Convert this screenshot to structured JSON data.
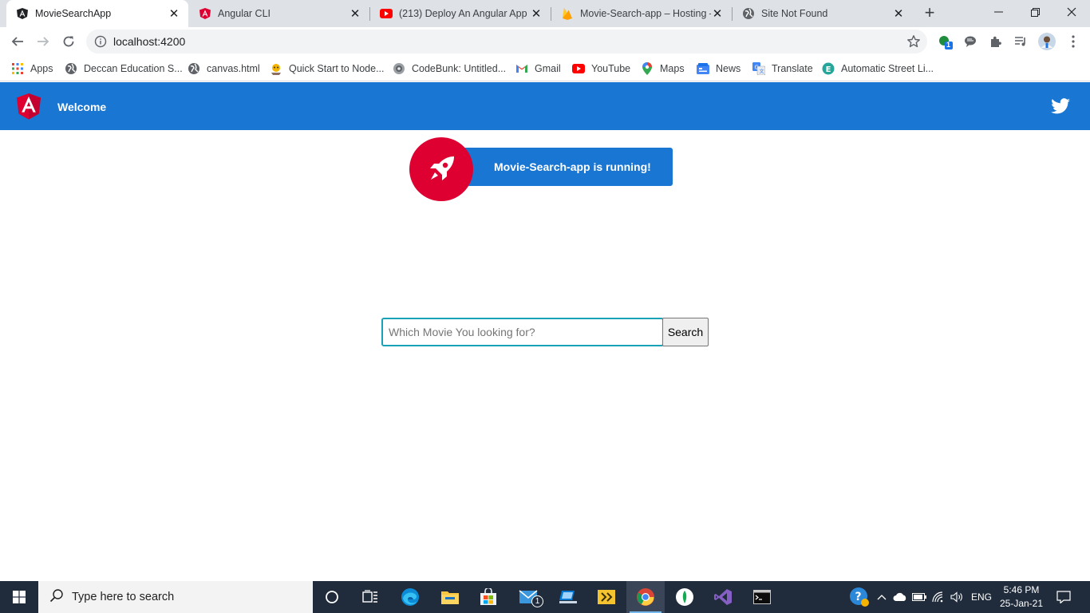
{
  "browser": {
    "tabs": [
      {
        "title": "MovieSearchApp",
        "icon": "angular-icon",
        "active": true
      },
      {
        "title": "Angular CLI",
        "icon": "angular-icon"
      },
      {
        "title": "(213) Deploy An Angular App T",
        "icon": "youtube-icon"
      },
      {
        "title": "Movie-Search-app – Hosting –",
        "icon": "firebase-icon"
      },
      {
        "title": "Site Not Found",
        "icon": "globe-icon"
      }
    ],
    "new_tab": "+",
    "address": "localhost:4200",
    "extension_badge": "1",
    "bookmarks": [
      {
        "label": "Apps",
        "icon": "apps-grid-icon"
      },
      {
        "label": "Deccan Education S...",
        "icon": "globe-icon"
      },
      {
        "label": "canvas.html",
        "icon": "globe-icon"
      },
      {
        "label": "Quick Start to Node...",
        "icon": "node-icon"
      },
      {
        "label": "CodeBunk: Untitled...",
        "icon": "codebunk-icon"
      },
      {
        "label": "Gmail",
        "icon": "gmail-icon"
      },
      {
        "label": "YouTube",
        "icon": "youtube-icon"
      },
      {
        "label": "Maps",
        "icon": "maps-icon"
      },
      {
        "label": "News",
        "icon": "news-icon"
      },
      {
        "label": "Translate",
        "icon": "translate-icon"
      },
      {
        "label": "Automatic Street Li...",
        "icon": "e-icon"
      }
    ]
  },
  "app": {
    "welcome": "Welcome",
    "running_text": "Movie-Search-app is running!",
    "search_placeholder": "Which Movie You looking for?",
    "search_button": "Search",
    "colors": {
      "toolbar": "#1976d2",
      "rocket": "#dd0031",
      "input_border": "#17a2b8"
    }
  },
  "taskbar": {
    "search_placeholder": "Type here to search",
    "mail_badge": "1",
    "language": "ENG",
    "time": "5:46 PM",
    "date": "25-Jan-21"
  }
}
